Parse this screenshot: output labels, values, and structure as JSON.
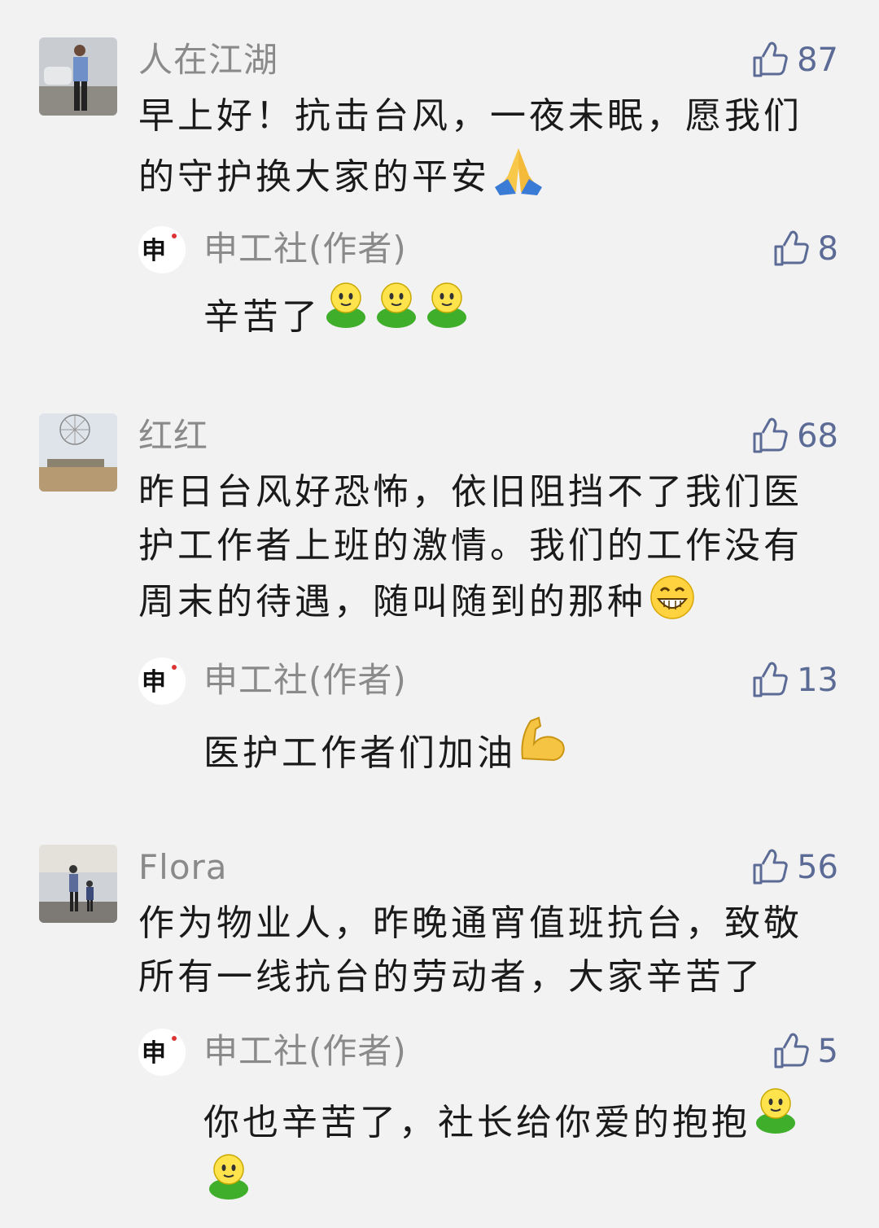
{
  "comments": [
    {
      "nickname": "人在江湖",
      "likes": "87",
      "text": "早上好！抗击台风，一夜未眠，愿我们的守护换大家的平安",
      "emoji": "pray-emoji",
      "reply": {
        "nickname": "申工社(作者)",
        "likes": "8",
        "text": "辛苦了",
        "emojis": [
          "hug-emoji",
          "hug-emoji",
          "hug-emoji"
        ]
      }
    },
    {
      "nickname": "红红",
      "likes": "68",
      "text": "昨日台风好恐怖，依旧阻挡不了我们医护工作者上班的激情。我们的工作没有周末的待遇，随叫随到的那种",
      "emoji": "grin-emoji",
      "reply": {
        "nickname": "申工社(作者)",
        "likes": "13",
        "text": "医护工作者们加油",
        "emojis": [
          "flexed-biceps-emoji"
        ]
      }
    },
    {
      "nickname": "Flora",
      "likes": "56",
      "text": "作为物业人，昨晚通宵值班抗台，致敬所有一线抗台的劳动者，大家辛苦了",
      "reply": {
        "nickname": "申工社(作者)",
        "likes": "5",
        "text": "你也辛苦了，社长给你爱的抱抱",
        "emojis": [
          "hug-emoji",
          "hug-emoji"
        ]
      }
    }
  ],
  "colors": {
    "background": "#f2f2f2",
    "nickname": "#8a8a8a",
    "like": "#5b6b95",
    "text": "#1a1a1a"
  }
}
